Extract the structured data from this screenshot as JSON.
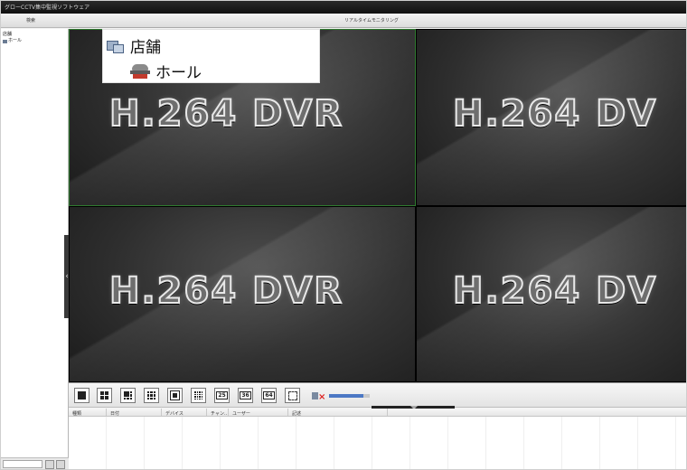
{
  "window": {
    "title": "グローCCTV集中監視ソフトウェア"
  },
  "header": {
    "left_label": "検索",
    "center_label": "リアルタイムモニタリング"
  },
  "sidebar": {
    "root_label": "店舗",
    "child_label": "ホール"
  },
  "callout": {
    "root_label": "店舗",
    "child_label": "ホール"
  },
  "video": {
    "tiles": [
      {
        "label": "H.264 DVR"
      },
      {
        "label": "H.264 DV"
      },
      {
        "label": "H.264 DVR"
      },
      {
        "label": "H.264 DV"
      }
    ]
  },
  "toolbar": {
    "buttons": [
      {
        "name": "layout-1-icon"
      },
      {
        "name": "layout-4-icon"
      },
      {
        "name": "layout-6-icon"
      },
      {
        "name": "layout-9-icon"
      },
      {
        "name": "layout-8-icon"
      },
      {
        "name": "layout-16-icon"
      },
      {
        "name": "layout-25-icon",
        "text": "25"
      },
      {
        "name": "layout-36-icon",
        "text": "36"
      },
      {
        "name": "layout-64-icon",
        "text": "64"
      },
      {
        "name": "fullscreen-icon"
      }
    ],
    "volume_level": 0.85
  },
  "log": {
    "columns": [
      "種類",
      "日付",
      "デバイス",
      "チャン..",
      "ユーザー",
      "記述"
    ]
  },
  "colors": {
    "selected_tile_border": "#2f7a2f",
    "volume_fill": "#4c78c4",
    "titlebar": "#111111"
  }
}
